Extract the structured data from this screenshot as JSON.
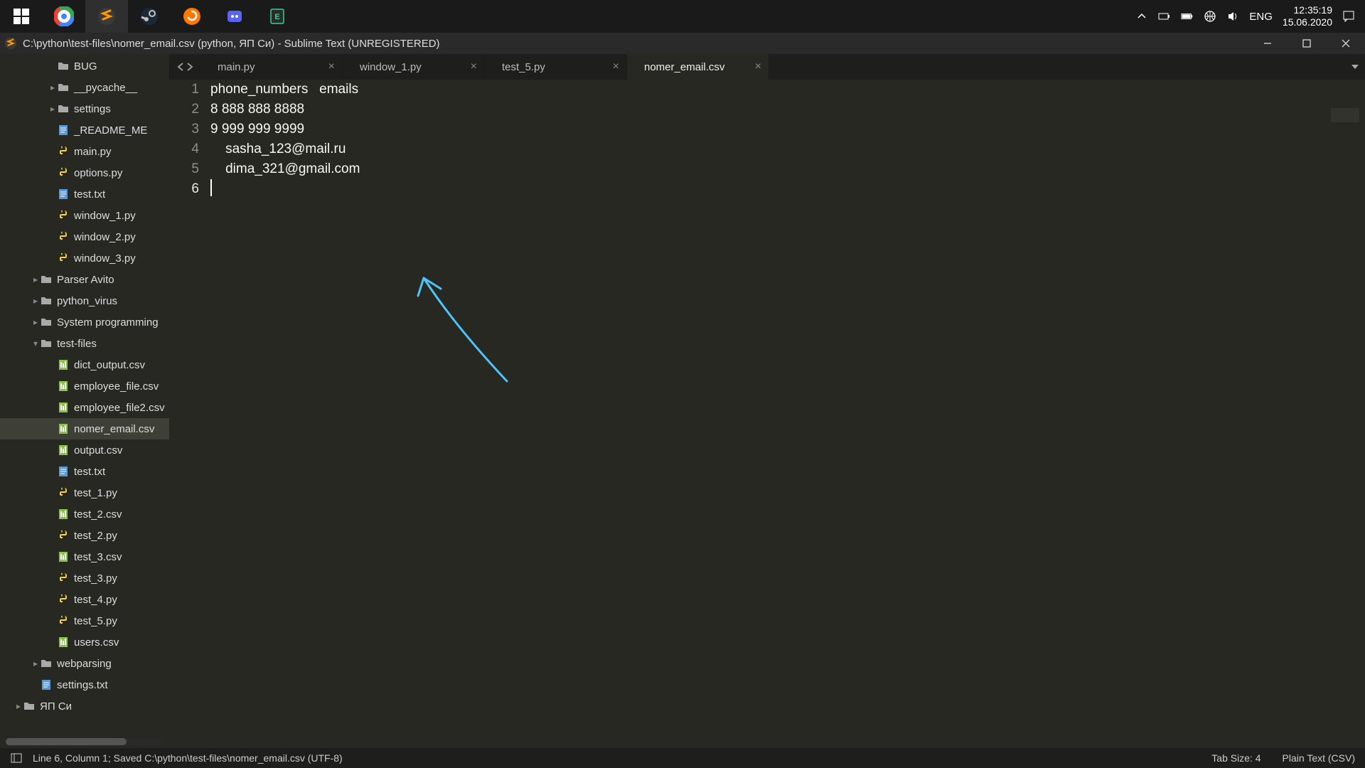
{
  "taskbar": {
    "lang": "ENG",
    "time": "12:35:19",
    "date": "15.06.2020"
  },
  "titlebar": {
    "text": "C:\\python\\test-files\\nomer_email.csv (python, ЯП Си) - Sublime Text (UNREGISTERED)"
  },
  "sidebar": {
    "items": [
      {
        "depth": 2,
        "arrow": "",
        "type": "folder",
        "name": "BUG"
      },
      {
        "depth": 2,
        "arrow": "▸",
        "type": "folder",
        "name": "__pycache__"
      },
      {
        "depth": 2,
        "arrow": "▸",
        "type": "folder",
        "name": "settings"
      },
      {
        "depth": 2,
        "arrow": "",
        "type": "txt",
        "name": "_README_ME"
      },
      {
        "depth": 2,
        "arrow": "",
        "type": "py",
        "name": "main.py"
      },
      {
        "depth": 2,
        "arrow": "",
        "type": "py",
        "name": "options.py"
      },
      {
        "depth": 2,
        "arrow": "",
        "type": "txt",
        "name": "test.txt"
      },
      {
        "depth": 2,
        "arrow": "",
        "type": "py",
        "name": "window_1.py"
      },
      {
        "depth": 2,
        "arrow": "",
        "type": "py",
        "name": "window_2.py"
      },
      {
        "depth": 2,
        "arrow": "",
        "type": "py",
        "name": "window_3.py"
      },
      {
        "depth": 1,
        "arrow": "▸",
        "type": "folder",
        "name": "Parser Avito"
      },
      {
        "depth": 1,
        "arrow": "▸",
        "type": "folder",
        "name": "python_virus"
      },
      {
        "depth": 1,
        "arrow": "▸",
        "type": "folder",
        "name": "System programming"
      },
      {
        "depth": 1,
        "arrow": "▾",
        "type": "folder",
        "name": "test-files"
      },
      {
        "depth": 2,
        "arrow": "",
        "type": "csv",
        "name": "dict_output.csv"
      },
      {
        "depth": 2,
        "arrow": "",
        "type": "csv",
        "name": "employee_file.csv"
      },
      {
        "depth": 2,
        "arrow": "",
        "type": "csv",
        "name": "employee_file2.csv"
      },
      {
        "depth": 2,
        "arrow": "",
        "type": "csv",
        "name": "nomer_email.csv",
        "active": true
      },
      {
        "depth": 2,
        "arrow": "",
        "type": "csv",
        "name": "output.csv"
      },
      {
        "depth": 2,
        "arrow": "",
        "type": "txt",
        "name": "test.txt"
      },
      {
        "depth": 2,
        "arrow": "",
        "type": "py",
        "name": "test_1.py"
      },
      {
        "depth": 2,
        "arrow": "",
        "type": "csv",
        "name": "test_2.csv"
      },
      {
        "depth": 2,
        "arrow": "",
        "type": "py",
        "name": "test_2.py"
      },
      {
        "depth": 2,
        "arrow": "",
        "type": "csv",
        "name": "test_3.csv"
      },
      {
        "depth": 2,
        "arrow": "",
        "type": "py",
        "name": "test_3.py"
      },
      {
        "depth": 2,
        "arrow": "",
        "type": "py",
        "name": "test_4.py"
      },
      {
        "depth": 2,
        "arrow": "",
        "type": "py",
        "name": "test_5.py"
      },
      {
        "depth": 2,
        "arrow": "",
        "type": "csv",
        "name": "users.csv"
      },
      {
        "depth": 1,
        "arrow": "▸",
        "type": "folder",
        "name": "webparsing"
      },
      {
        "depth": 1,
        "arrow": "",
        "type": "txt",
        "name": "settings.txt"
      },
      {
        "depth": 0,
        "arrow": "▸",
        "type": "folder",
        "name": "ЯП Си"
      }
    ]
  },
  "tabs": [
    {
      "label": "main.py",
      "active": false
    },
    {
      "label": "window_1.py",
      "active": false
    },
    {
      "label": "test_5.py",
      "active": false
    },
    {
      "label": "nomer_email.csv",
      "active": true
    }
  ],
  "editor": {
    "lines": [
      "phone_numbers   emails",
      "8 888 888 8888",
      "9 999 999 9999",
      "    sasha_123@mail.ru",
      "    dima_321@gmail.com",
      ""
    ],
    "current_line": 6
  },
  "statusbar": {
    "cursor": "Line 6, Column 1; Saved C:\\python\\test-files\\nomer_email.csv (UTF-8)",
    "tab_size": "Tab Size: 4",
    "syntax": "Plain Text (CSV)"
  }
}
